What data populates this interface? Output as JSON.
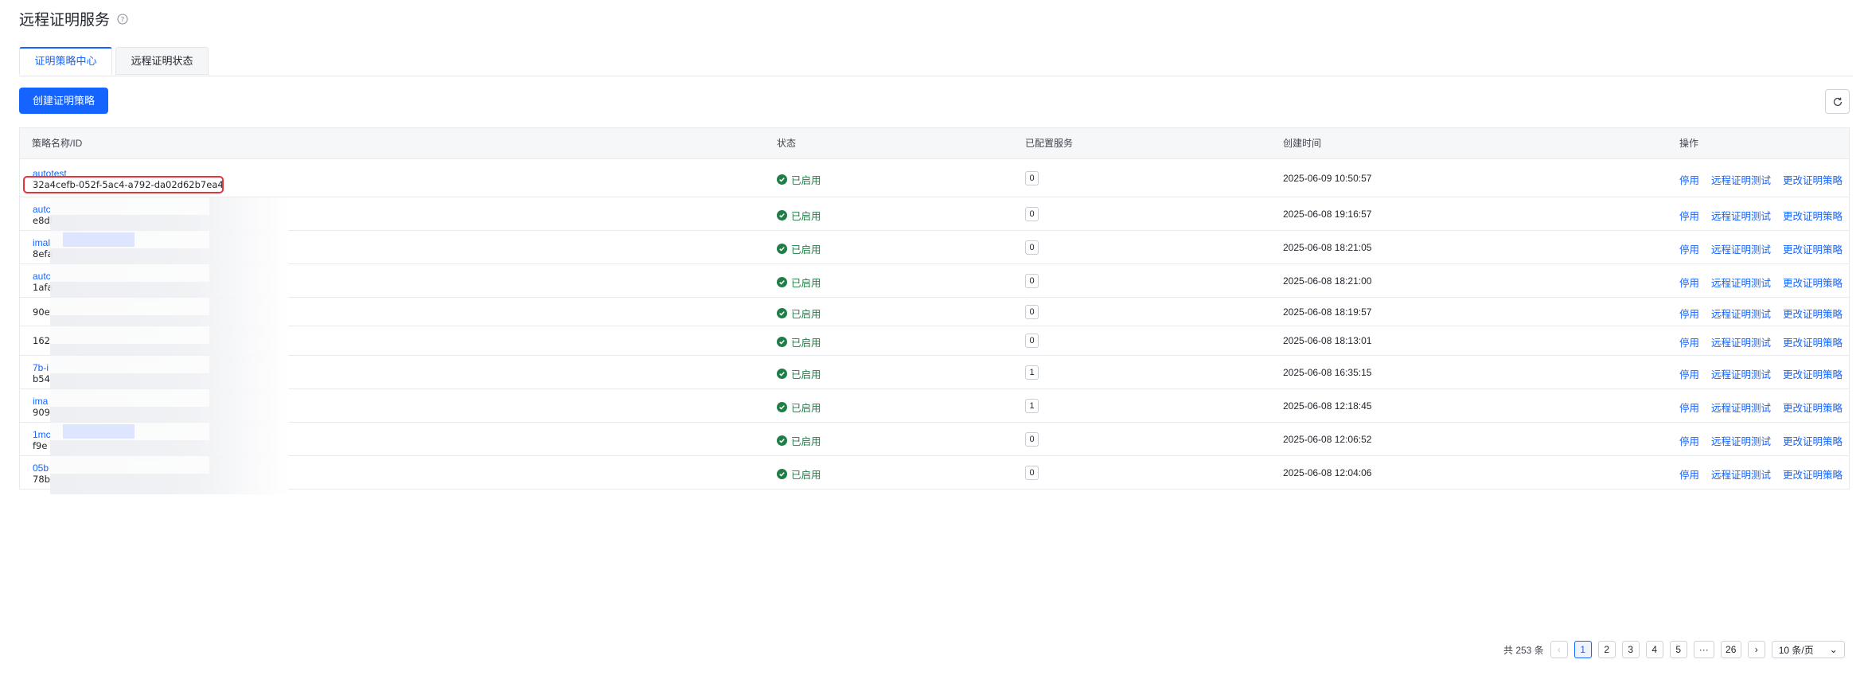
{
  "page": {
    "title": "远程证明服务"
  },
  "tabs": [
    {
      "label": "证明策略中心",
      "active": true
    },
    {
      "label": "远程证明状态",
      "active": false
    }
  ],
  "toolbar": {
    "create_label": "创建证明策略"
  },
  "table": {
    "headers": {
      "name": "策略名称/ID",
      "status": "状态",
      "services": "已配置服务",
      "created": "创建时间",
      "actions": "操作"
    },
    "action_labels": {
      "disable": "停用",
      "test": "远程证明测试",
      "edit": "更改证明策略"
    },
    "rows": [
      {
        "name": "autotest",
        "id": "32a4cefb-052f-5ac4-a792-da02d62b7ea4",
        "status": "已启用",
        "services": "0",
        "created": "2025-06-09 10:50:57"
      },
      {
        "name": "autc",
        "id": "e8dl",
        "status": "已启用",
        "services": "0",
        "created": "2025-06-08 19:16:57"
      },
      {
        "name": "imal",
        "id": "8efa",
        "status": "已启用",
        "services": "0",
        "created": "2025-06-08 18:21:05"
      },
      {
        "name": "autc",
        "id": "1afa",
        "status": "已启用",
        "services": "0",
        "created": "2025-06-08 18:21:00"
      },
      {
        "name": "",
        "id": "90e",
        "status": "已启用",
        "services": "0",
        "created": "2025-06-08 18:19:57"
      },
      {
        "name": "",
        "id": "162",
        "status": "已启用",
        "services": "0",
        "created": "2025-06-08 18:13:01"
      },
      {
        "name": "7b-i",
        "id": "b54",
        "status": "已启用",
        "services": "1",
        "created": "2025-06-08 16:35:15"
      },
      {
        "name": "ima",
        "id": "909",
        "status": "已启用",
        "services": "1",
        "created": "2025-06-08 12:18:45"
      },
      {
        "name": "1mc",
        "id": "f9e",
        "status": "已启用",
        "services": "0",
        "created": "2025-06-08 12:06:52"
      },
      {
        "name": "05b",
        "id": "78b",
        "status": "已启用",
        "services": "0",
        "created": "2025-06-08 12:04:06"
      }
    ]
  },
  "pagination": {
    "total_label": "共 253 条",
    "pages": [
      "1",
      "2",
      "3",
      "4",
      "5",
      "···",
      "26"
    ],
    "current": "1",
    "page_size_label": "10 条/页"
  },
  "colors": {
    "primary": "#1664ff",
    "status_green": "#1f7d46",
    "highlight_red": "#e5343a"
  }
}
